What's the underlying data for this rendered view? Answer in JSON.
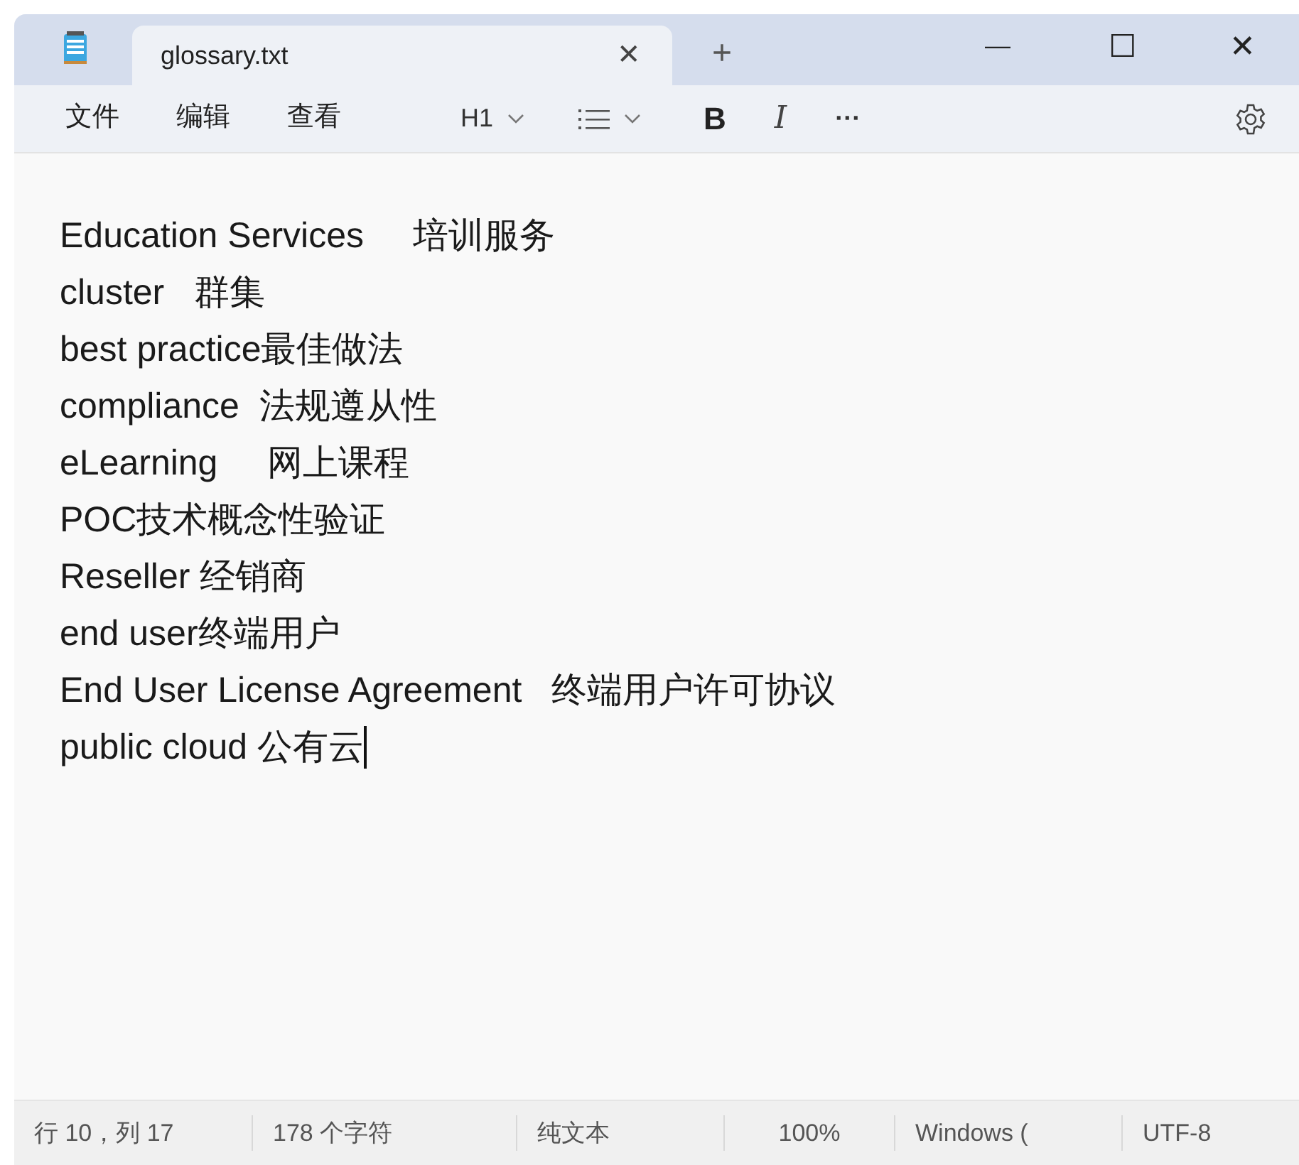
{
  "window": {
    "minimize": "—",
    "maximize": "☐",
    "close": "✕"
  },
  "tabs": [
    {
      "label": "glossary.txt",
      "selected": true,
      "close": "✕"
    }
  ],
  "new_tab": "+",
  "menu": [
    "文件",
    "编辑",
    "查看"
  ],
  "toolbar": {
    "heading": "H1",
    "bold": "B",
    "italic": "I",
    "more": "···"
  },
  "lines": [
    "Education Services     培训服务",
    "cluster   群集",
    "best practice最佳做法",
    "compliance  法规遵从性",
    "eLearning     网上课程",
    "POC技术概念性验证",
    "Reseller 经销商",
    "end user终端用户",
    "End User License Agreement   终端用户许可协议",
    "public cloud 公有云"
  ],
  "status_bar": [
    "行 10，列 17",
    "178 个字符",
    "纯文本",
    "100%",
    "Windows (",
    "UTF-8"
  ]
}
